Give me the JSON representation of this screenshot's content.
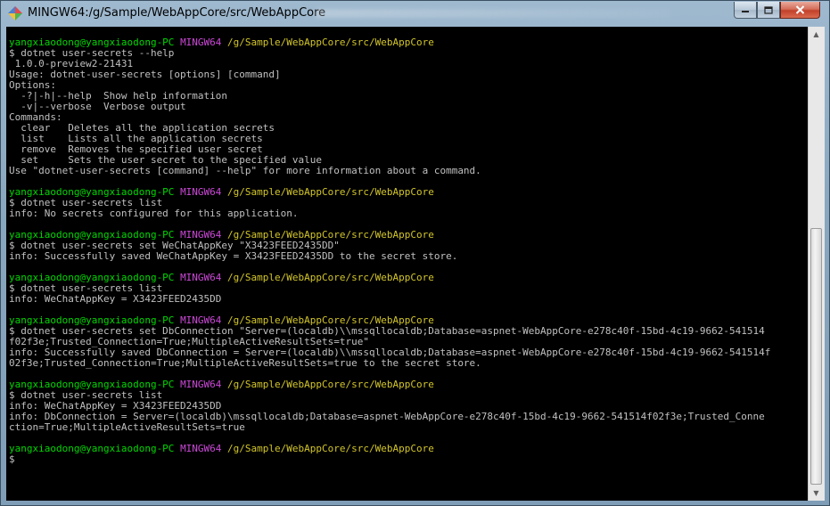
{
  "window": {
    "title": "MINGW64:/g/Sample/WebAppCore/src/WebAppCore",
    "icon": "mingw-diamond-icon"
  },
  "prompt": {
    "user_host": "yangxiaodong@yangxiaodong-PC",
    "shell": "MINGW64",
    "path": "/g/Sample/WebAppCore/src/WebAppCore",
    "symbol": "$"
  },
  "colors": {
    "background": "#000000",
    "user_host": "#00d800",
    "shell": "#cc48d8",
    "path": "#d2c52a",
    "text": "#c0c0c0"
  },
  "lines": [
    {
      "type": "prompt"
    },
    {
      "type": "text",
      "text": "$ dotnet user-secrets --help"
    },
    {
      "type": "text",
      "text": " 1.0.0-preview2-21431"
    },
    {
      "type": "text",
      "text": "Usage: dotnet-user-secrets [options] [command]"
    },
    {
      "type": "text",
      "text": "Options:"
    },
    {
      "type": "text",
      "text": "  -?|-h|--help  Show help information"
    },
    {
      "type": "text",
      "text": "  -v|--verbose  Verbose output"
    },
    {
      "type": "text",
      "text": "Commands:"
    },
    {
      "type": "text",
      "text": "  clear   Deletes all the application secrets"
    },
    {
      "type": "text",
      "text": "  list    Lists all the application secrets"
    },
    {
      "type": "text",
      "text": "  remove  Removes the specified user secret"
    },
    {
      "type": "text",
      "text": "  set     Sets the user secret to the specified value"
    },
    {
      "type": "text",
      "text": "Use \"dotnet-user-secrets [command] --help\" for more information about a command."
    },
    {
      "type": "text",
      "text": ""
    },
    {
      "type": "prompt"
    },
    {
      "type": "text",
      "text": "$ dotnet user-secrets list"
    },
    {
      "type": "text",
      "text": "info: No secrets configured for this application."
    },
    {
      "type": "text",
      "text": ""
    },
    {
      "type": "prompt"
    },
    {
      "type": "text",
      "text": "$ dotnet user-secrets set WeChatAppKey \"X3423FEED2435DD\""
    },
    {
      "type": "text",
      "text": "info: Successfully saved WeChatAppKey = X3423FEED2435DD to the secret store."
    },
    {
      "type": "text",
      "text": ""
    },
    {
      "type": "prompt"
    },
    {
      "type": "text",
      "text": "$ dotnet user-secrets list"
    },
    {
      "type": "text",
      "text": "info: WeChatAppKey = X3423FEED2435DD"
    },
    {
      "type": "text",
      "text": ""
    },
    {
      "type": "prompt"
    },
    {
      "type": "text",
      "text": "$ dotnet user-secrets set DbConnection \"Server=(localdb)\\\\mssqllocaldb;Database=aspnet-WebAppCore-e278c40f-15bd-4c19-9662-541514"
    },
    {
      "type": "text",
      "text": "f02f3e;Trusted_Connection=True;MultipleActiveResultSets=true\""
    },
    {
      "type": "text",
      "text": "info: Successfully saved DbConnection = Server=(localdb)\\\\mssqllocaldb;Database=aspnet-WebAppCore-e278c40f-15bd-4c19-9662-541514f"
    },
    {
      "type": "text",
      "text": "02f3e;Trusted_Connection=True;MultipleActiveResultSets=true to the secret store."
    },
    {
      "type": "text",
      "text": ""
    },
    {
      "type": "prompt"
    },
    {
      "type": "text",
      "text": "$ dotnet user-secrets list"
    },
    {
      "type": "text",
      "text": "info: WeChatAppKey = X3423FEED2435DD"
    },
    {
      "type": "text",
      "text": "info: DbConnection = Server=(localdb)\\mssqllocaldb;Database=aspnet-WebAppCore-e278c40f-15bd-4c19-9662-541514f02f3e;Trusted_Conne"
    },
    {
      "type": "text",
      "text": "ction=True;MultipleActiveResultSets=true"
    },
    {
      "type": "text",
      "text": ""
    },
    {
      "type": "prompt"
    },
    {
      "type": "text",
      "text": "$"
    }
  ]
}
